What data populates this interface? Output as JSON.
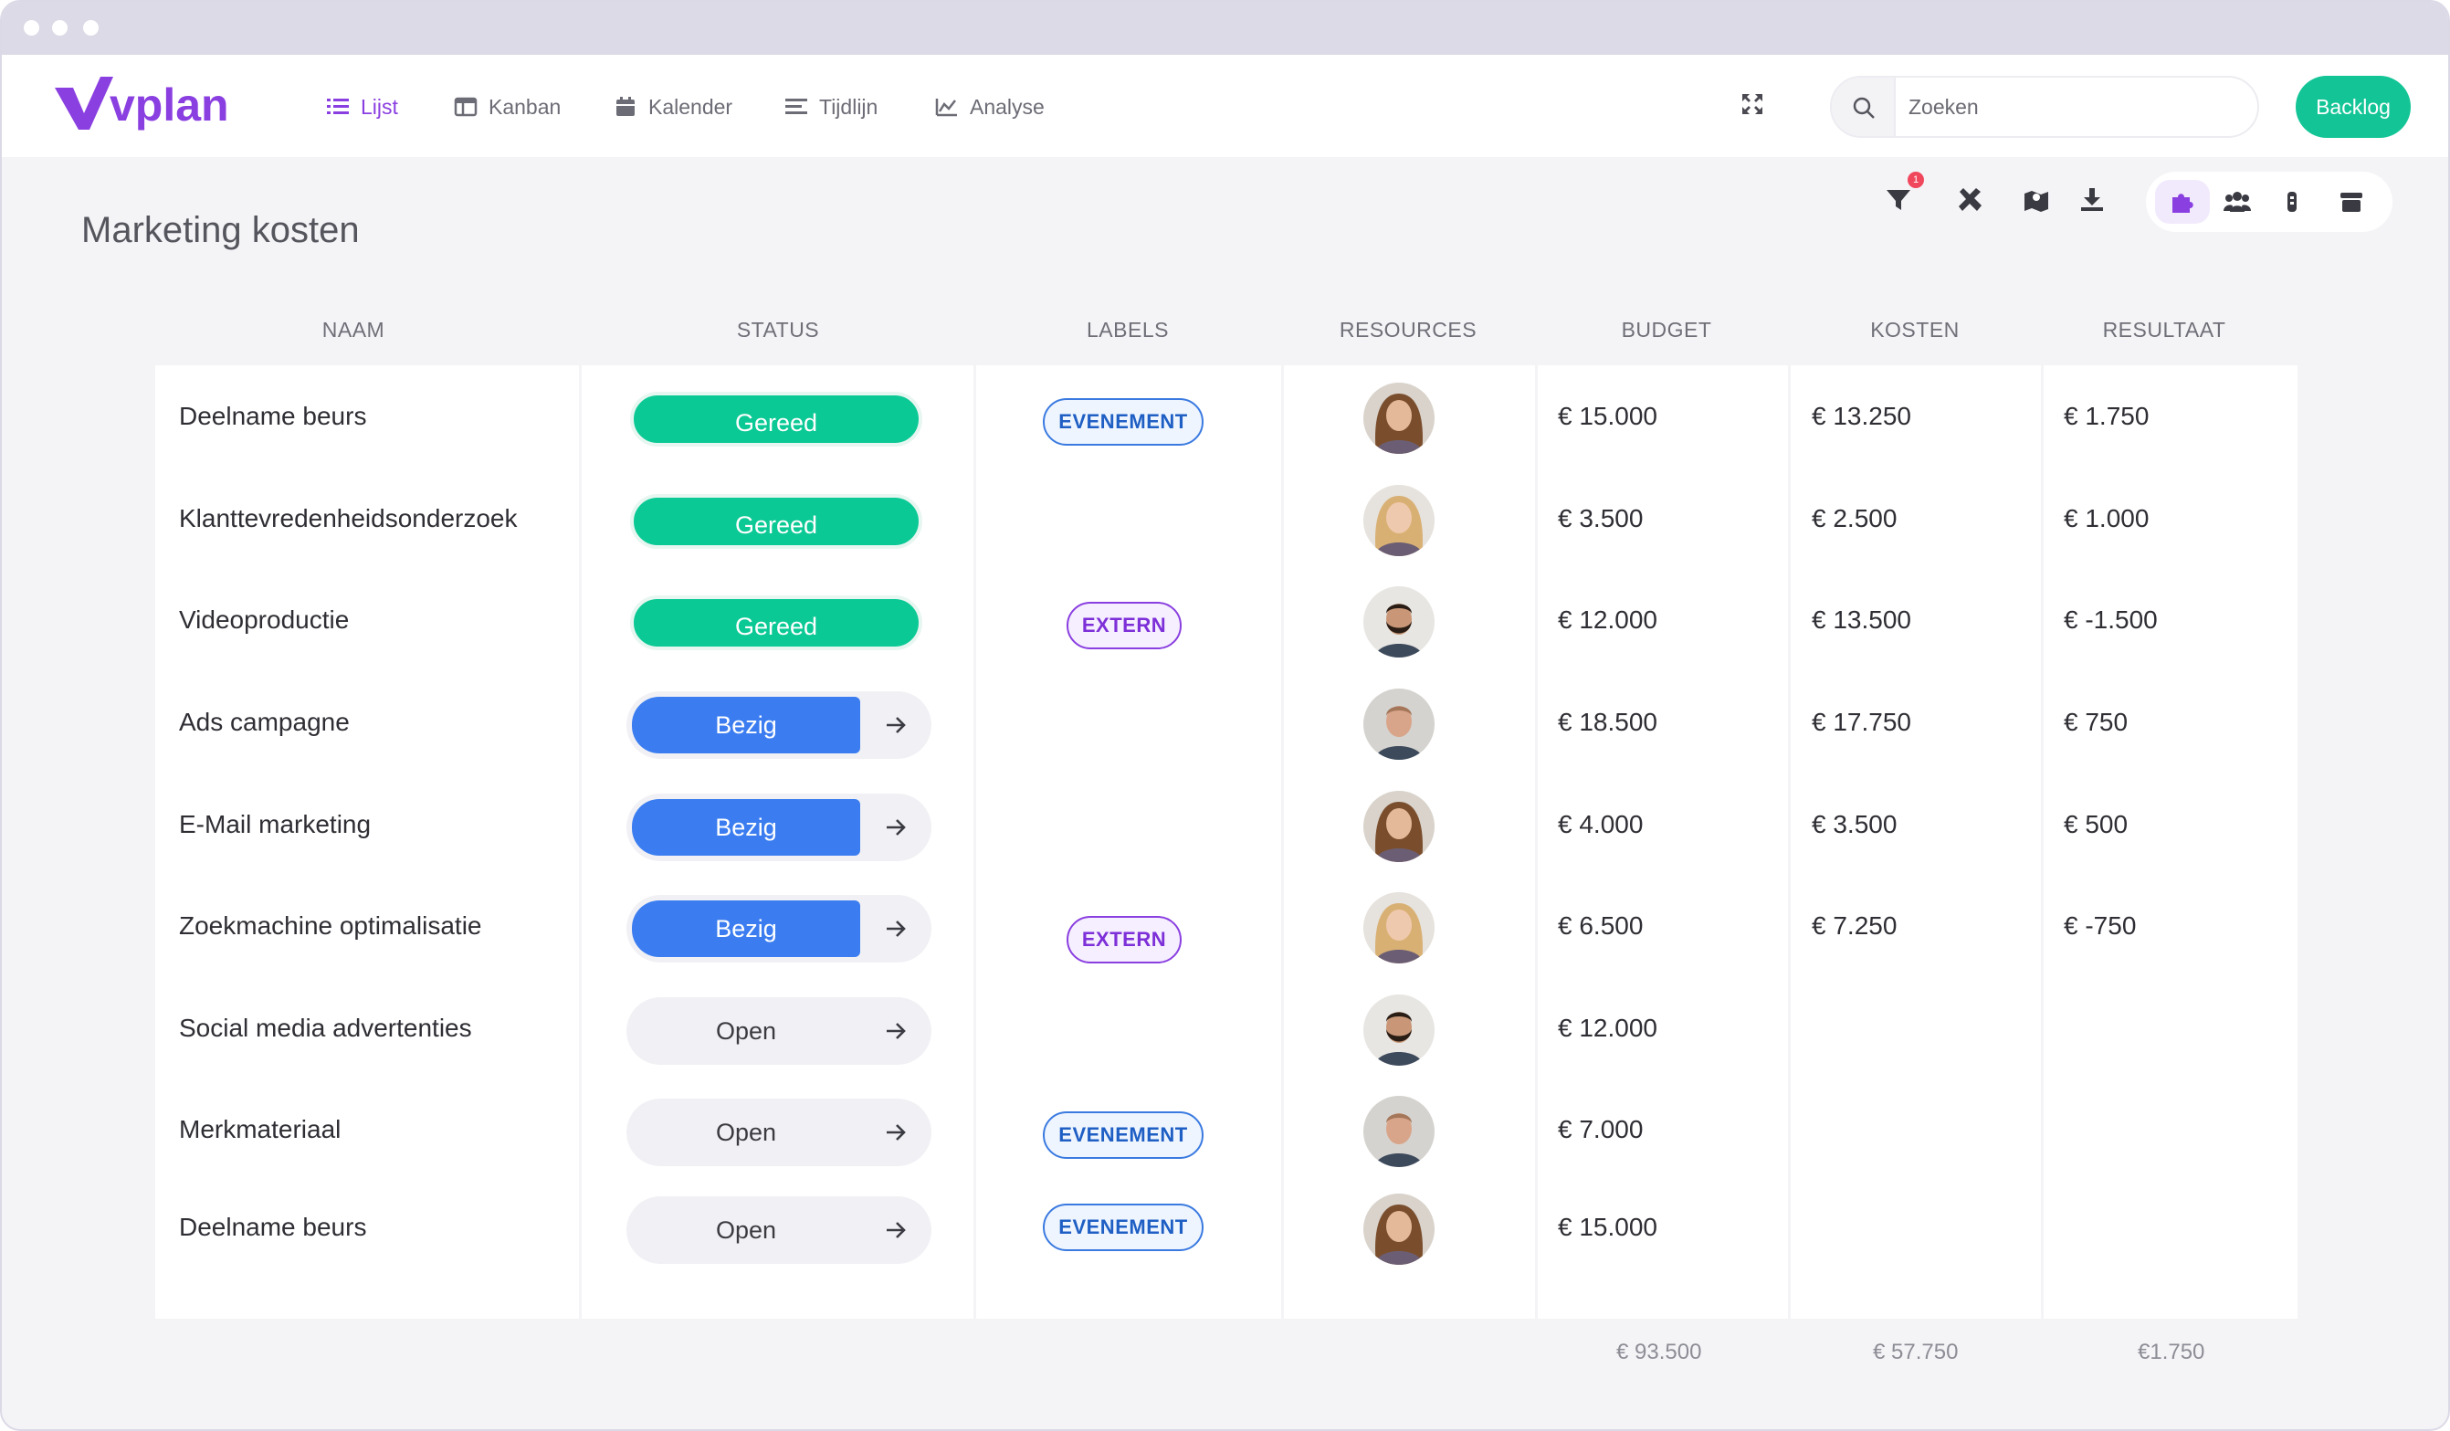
{
  "app": {
    "logo_text": "vplan",
    "brand_color": "#8a3fe0",
    "accent_green": "#13c596",
    "accent_blue": "#3b7df0"
  },
  "nav": {
    "tabs": [
      {
        "label": "Lijst",
        "icon": "list-icon",
        "active": true
      },
      {
        "label": "Kanban",
        "icon": "kanban-icon",
        "active": false
      },
      {
        "label": "Kalender",
        "icon": "calendar-icon",
        "active": false
      },
      {
        "label": "Tijdlijn",
        "icon": "timeline-icon",
        "active": false
      },
      {
        "label": "Analyse",
        "icon": "chart-icon",
        "active": false
      }
    ],
    "search_placeholder": "Zoeken",
    "backlog_label": "Backlog"
  },
  "toolbar": {
    "filter_badge": "1",
    "icons": [
      "filter-icon",
      "tools-icon",
      "map-icon",
      "download-icon"
    ],
    "view_icons": [
      "puzzle-icon",
      "team-icon",
      "cylinder-icon",
      "archive-icon"
    ]
  },
  "page": {
    "title": "Marketing kosten"
  },
  "table": {
    "columns": [
      "NAAM",
      "STATUS",
      "LABELS",
      "RESOURCES",
      "BUDGET",
      "KOSTEN",
      "RESULTAAT"
    ],
    "rows": [
      {
        "name": "Deelname beurs",
        "status": "Gereed",
        "status_type": "done",
        "label": "EVENEMENT",
        "avatar": "woman-brown",
        "budget": "€ 15.000",
        "kosten": "€ 13.250",
        "resultaat": "€ 1.750"
      },
      {
        "name": "Klanttevredenheidsonderzoek",
        "status": "Gereed",
        "status_type": "done",
        "label": "",
        "avatar": "woman-blonde",
        "budget": "€ 3.500",
        "kosten": "€ 2.500",
        "resultaat": "€ 1.000"
      },
      {
        "name": "Videoproductie",
        "status": "Gereed",
        "status_type": "done",
        "label": "EXTERN",
        "avatar": "man-beard",
        "budget": "€ 12.000",
        "kosten": "€ 13.500",
        "resultaat": "€ -1.500"
      },
      {
        "name": "Ads campagne",
        "status": "Bezig",
        "status_type": "busy",
        "label": "",
        "avatar": "man-bald",
        "budget": "€ 18.500",
        "kosten": "€ 17.750",
        "resultaat": "€ 750"
      },
      {
        "name": "E-Mail marketing",
        "status": "Bezig",
        "status_type": "busy",
        "label": "",
        "avatar": "woman-brown",
        "budget": "€ 4.000",
        "kosten": "€ 3.500",
        "resultaat": "€ 500"
      },
      {
        "name": "Zoekmachine optimalisatie",
        "status": "Bezig",
        "status_type": "busy",
        "label": "EXTERN",
        "avatar": "woman-blonde",
        "budget": "€ 6.500",
        "kosten": "€ 7.250",
        "resultaat": "€ -750"
      },
      {
        "name": "Social media advertenties",
        "status": "Open",
        "status_type": "open",
        "label": "",
        "avatar": "man-beard",
        "budget": "€ 12.000",
        "kosten": "",
        "resultaat": ""
      },
      {
        "name": "Merkmateriaal",
        "status": "Open",
        "status_type": "open",
        "label": "EVENEMENT",
        "avatar": "man-bald",
        "budget": "€ 7.000",
        "kosten": "",
        "resultaat": ""
      },
      {
        "name": "Deelname beurs",
        "status": "Open",
        "status_type": "open",
        "label": "EVENEMENT",
        "avatar": "woman-brown",
        "budget": "€ 15.000",
        "kosten": "",
        "resultaat": ""
      }
    ],
    "totals": {
      "budget": "€ 93.500",
      "kosten": "€ 57.750",
      "resultaat": "€1.750"
    }
  }
}
